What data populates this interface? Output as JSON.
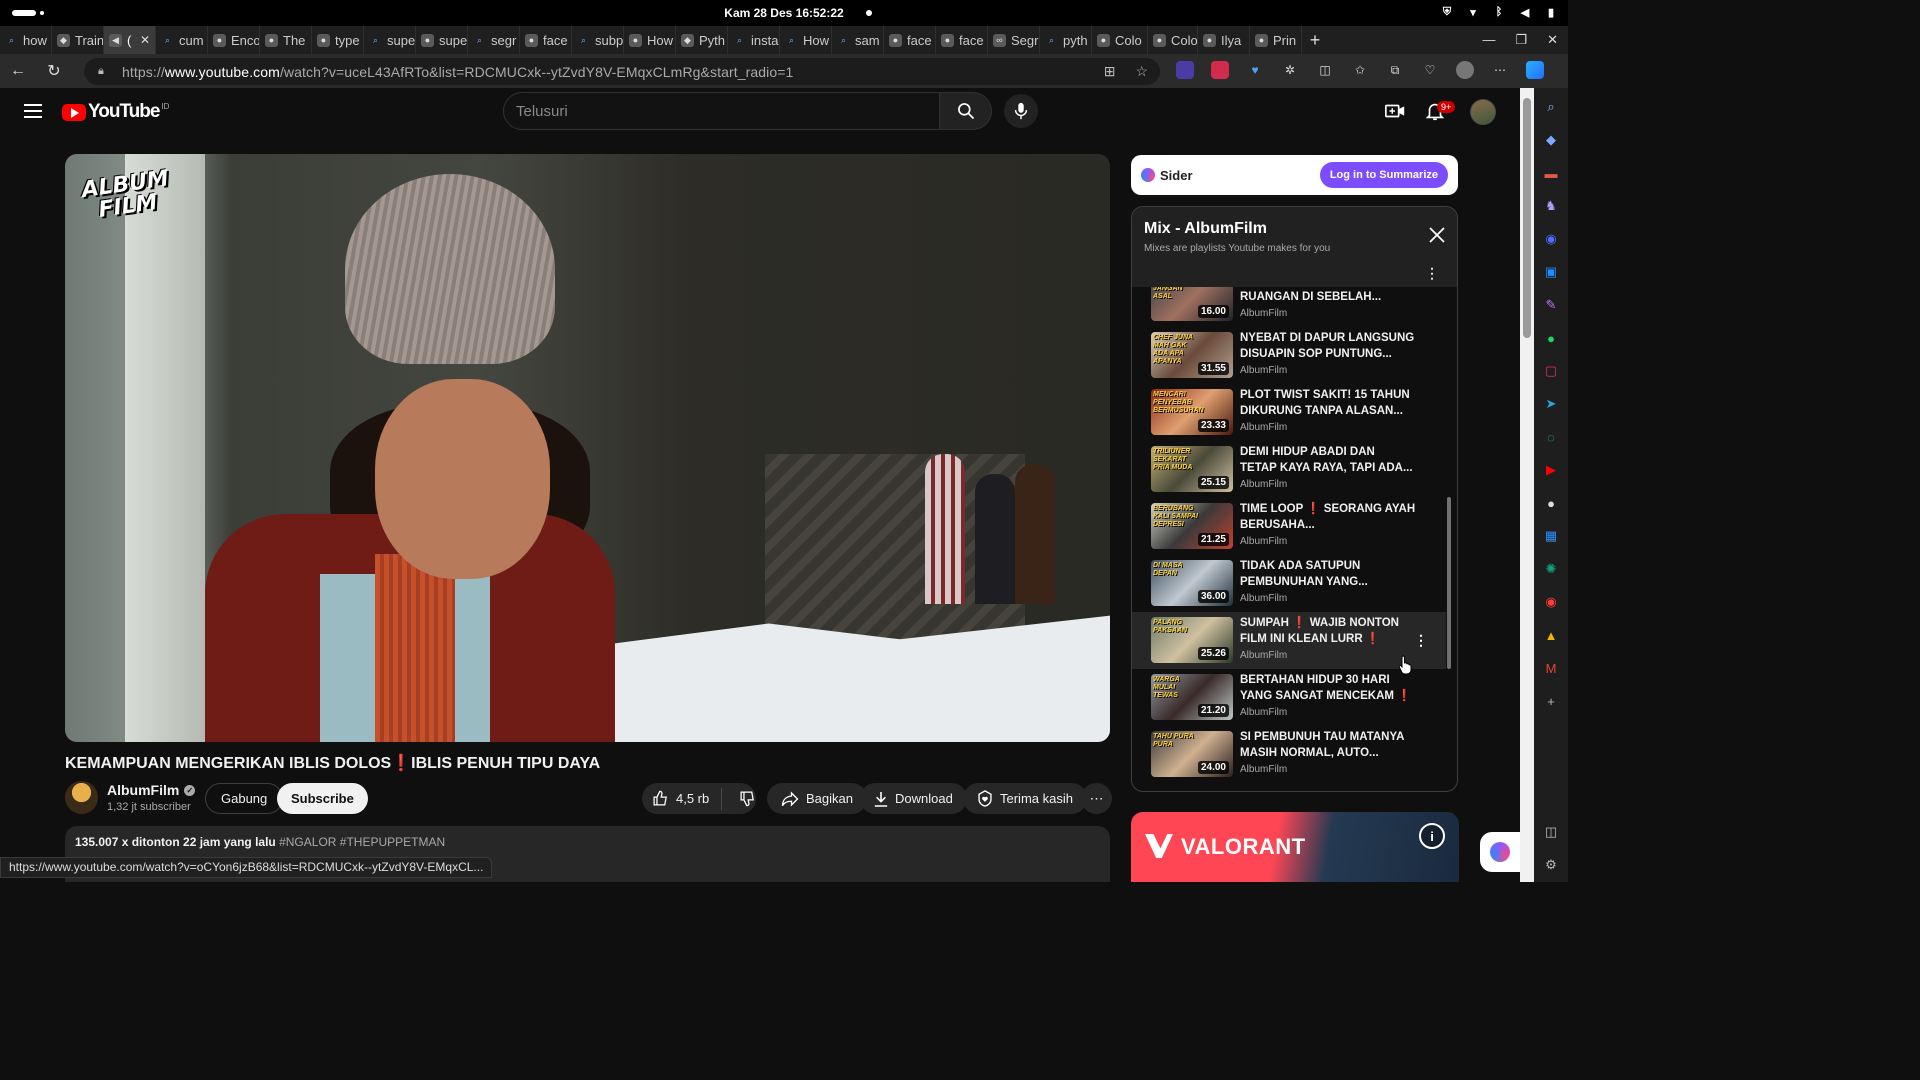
{
  "os": {
    "datetime": "Kam 28 Des  16:52:22"
  },
  "tabs": [
    {
      "label": "how",
      "icon": "search-icon"
    },
    {
      "label": "Train",
      "icon": "shield-icon"
    },
    {
      "label": "(",
      "icon": "speaker-icon",
      "active": true
    },
    {
      "label": "cum",
      "icon": "search-icon"
    },
    {
      "label": "Enco",
      "icon": "app-icon"
    },
    {
      "label": "The",
      "icon": "app-icon"
    },
    {
      "label": "type",
      "icon": "github-icon"
    },
    {
      "label": "supe",
      "icon": "search-icon"
    },
    {
      "label": "supe",
      "icon": "app-icon"
    },
    {
      "label": "segr",
      "icon": "search-icon"
    },
    {
      "label": "face",
      "icon": "github-icon"
    },
    {
      "label": "subp",
      "icon": "search-icon"
    },
    {
      "label": "How",
      "icon": "app-icon"
    },
    {
      "label": "Pyth",
      "icon": "python-icon"
    },
    {
      "label": "insta",
      "icon": "search-icon"
    },
    {
      "label": "How",
      "icon": "search-icon"
    },
    {
      "label": "sam",
      "icon": "search-icon"
    },
    {
      "label": "face",
      "icon": "github-icon"
    },
    {
      "label": "face",
      "icon": "github-icon"
    },
    {
      "label": "Segr",
      "icon": "meta-icon"
    },
    {
      "label": "pyth",
      "icon": "search-icon"
    },
    {
      "label": "Colo",
      "icon": "app-icon"
    },
    {
      "label": "Colo",
      "icon": "app-icon"
    },
    {
      "label": "Ilya",
      "icon": "app-icon"
    },
    {
      "label": "Prin",
      "icon": "app-icon"
    }
  ],
  "address": {
    "url_prefix": "https://",
    "url_host": "www.youtube.com",
    "url_path": "/watch?v=uceL43AfRTo&list=RDCMUCxk--ytZvdY8V-EMqxCLmRg&start_radio=1"
  },
  "yt": {
    "logo_text": "YouTube",
    "country_code": "ID",
    "search_placeholder": "Telusuri",
    "notif_count": "9+"
  },
  "video": {
    "overlay_line1": "ALBUM",
    "overlay_line2": "FILM",
    "title_part1": "KEMAMPUAN MENGERIKAN IBLIS DOLOS",
    "title_mark": "❗",
    "title_part2": "IBLIS PENUH TIPU DAYA",
    "channel": "AlbumFilm",
    "subscribers": "1,32 jt subscriber",
    "join_label": "Gabung",
    "subscribe_label": "Subscribe",
    "likes": "4,5 rb",
    "share_label": "Bagikan",
    "download_label": "Download",
    "thanks_label": "Terima kasih",
    "views_time": "135.007 x ditonton  22 jam yang lalu",
    "hashtags": "#NGALOR #THEPUPPETMAN"
  },
  "status_url": "https://www.youtube.com/watch?v=oCYon6jzB68&list=RDCMUCxk--ytZvdY8V-EMqxCL...",
  "sider": {
    "name": "Sider",
    "login_label": "Log in to Summarize"
  },
  "playlist": {
    "title": "Mix - AlbumFilm",
    "subtitle": "Mixes are playlists Youtube makes for you",
    "items": [
      {
        "line1": "PRIA INI TIDAK TAHU",
        "line2": "RUANGAN DI SEBELAH...",
        "channel": "AlbumFilm",
        "duration": "16.00",
        "cap": "OTAK JANGAN ASAL"
      },
      {
        "line1": "NYEBAT DI DAPUR LANGSUNG",
        "line2": "DISUAPIN SOP PUNTUNG...",
        "channel": "AlbumFilm",
        "duration": "31.55",
        "cap": "CHEF JUNA MAH GAK ADA APA APANYA"
      },
      {
        "line1": "PLOT TWIST SAKIT! 15 TAHUN",
        "line2": "DIKURUNG TANPA ALASAN...",
        "channel": "AlbumFilm",
        "duration": "23.33",
        "cap": "MENCARI PENYEBAB BERMUSUHAN"
      },
      {
        "line1": "DEMI HIDUP ABADI DAN",
        "line2": "TETAP KAYA RAYA, TAPI ADA...",
        "channel": "AlbumFilm",
        "duration": "25.15",
        "cap": "TRILIUNER SEKARAT PRIA MUDA"
      },
      {
        "line1": "TIME LOOP ❗ SEORANG AYAH",
        "line2": "BERUSAHA...",
        "channel": "AlbumFilm",
        "duration": "21.25",
        "cap": "BERUBANG KALI SAMPAI DEPRESI"
      },
      {
        "line1": "TIDAK ADA SATUPUN",
        "line2": "PEMBUNUHAN YANG...",
        "channel": "AlbumFilm",
        "duration": "36.00",
        "cap": "DI MASA DEPAN"
      },
      {
        "line1": "SUMPAH ❗ WAJIB NONTON",
        "line2": "FILM INI KLEAN LURR ❗",
        "channel": "AlbumFilm",
        "duration": "25.26",
        "cap": "PALANG PAKSAAN"
      },
      {
        "line1": "BERTAHAN HIDUP 30 HARI",
        "line2": "YANG SANGAT MENCEKAM ❗",
        "channel": "AlbumFilm",
        "duration": "21.20",
        "cap": "WARGA MULAI TEWAS"
      },
      {
        "line1": "SI PEMBUNUH TAU MATANYA",
        "line2": "MASIH NORMAL, AUTO...",
        "channel": "AlbumFilm",
        "duration": "24.00",
        "cap": "TAHU PURA PURA"
      }
    ]
  },
  "ad": {
    "brand": "VALORANT"
  }
}
